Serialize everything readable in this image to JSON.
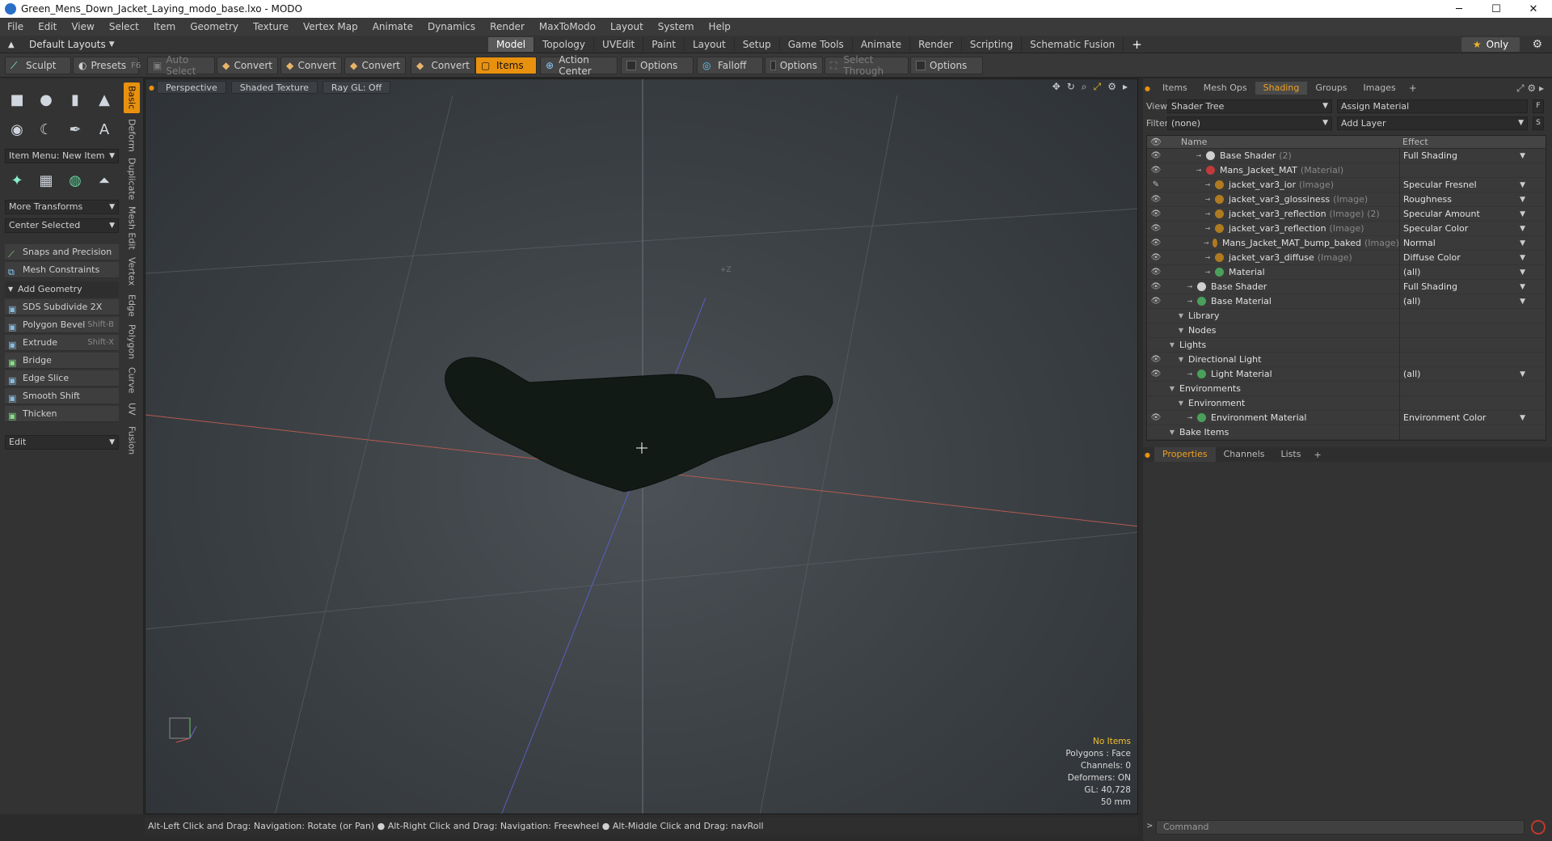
{
  "window": {
    "title": "Green_Mens_Down_Jacket_Laying_modo_base.lxo - MODO",
    "min": "─",
    "max": "☐",
    "close": "✕"
  },
  "menu": [
    "File",
    "Edit",
    "View",
    "Select",
    "Item",
    "Geometry",
    "Texture",
    "Vertex Map",
    "Animate",
    "Dynamics",
    "Render",
    "MaxToModo",
    "Layout",
    "System",
    "Help"
  ],
  "layout": {
    "name": "Default Layouts",
    "tabs": [
      "Model",
      "Topology",
      "UVEdit",
      "Paint",
      "Layout",
      "Setup",
      "Game Tools",
      "Animate",
      "Render",
      "Scripting",
      "Schematic Fusion"
    ],
    "active_tab": "Model",
    "only": "Only"
  },
  "toolbar": {
    "sculpt": "Sculpt",
    "presets": "Presets",
    "presets_key": "F6",
    "auto_select": "Auto Select",
    "convert": "Convert",
    "items": "Items",
    "action_center": "Action Center",
    "options": "Options",
    "falloff": "Falloff",
    "select_through": "Select Through"
  },
  "left": {
    "vtabs": [
      "Basic",
      "Deform",
      "Duplicate",
      "Mesh Edit",
      "Vertex",
      "Edge",
      "Polygon",
      "Curve",
      "UV",
      "Fusion"
    ],
    "item_menu": "Item Menu: New Item",
    "more_transforms": "More Transforms",
    "center_selected": "Center Selected",
    "snaps": "Snaps and Precision",
    "mesh_constraints": "Mesh Constraints",
    "add_geometry": "Add Geometry",
    "tools": [
      {
        "label": "SDS Subdivide 2X",
        "key": ""
      },
      {
        "label": "Polygon Bevel",
        "key": "Shift-B"
      },
      {
        "label": "Extrude",
        "key": "Shift-X"
      },
      {
        "label": "Bridge",
        "key": ""
      },
      {
        "label": "Edge Slice",
        "key": ""
      },
      {
        "label": "Smooth Shift",
        "key": ""
      },
      {
        "label": "Thicken",
        "key": ""
      }
    ],
    "edit": "Edit"
  },
  "viewport": {
    "view": "Perspective",
    "shading": "Shaded Texture",
    "raygl": "Ray GL: Off",
    "axis_label": "+Z",
    "info": [
      "No Items",
      "Polygons : Face",
      "Channels: 0",
      "Deformers: ON",
      "GL: 40,728",
      "50 mm"
    ]
  },
  "status": "Alt-Left Click and Drag: Navigation: Rotate (or Pan) ● Alt-Right Click and Drag: Navigation: Freewheel ● Alt-Middle Click and Drag: navRoll",
  "right": {
    "tabs": [
      "Items",
      "Mesh Ops",
      "Shading",
      "Groups",
      "Images"
    ],
    "active_tab": "Shading",
    "view_label": "View",
    "view_value": "Shader Tree",
    "assign": "Assign Material",
    "filter_label": "Filter",
    "filter_value": "(none)",
    "add_layer": "Add Layer",
    "col_name": "Name",
    "col_effect": "Effect",
    "rows": [
      {
        "indent": 3,
        "name": "Base Shader",
        "muted": "(2)",
        "effect": "Full Shading",
        "ball": "#d0d0d0",
        "eye": "👁"
      },
      {
        "indent": 3,
        "name": "Mans_Jacket_MAT",
        "muted": "(Material)",
        "effect": "",
        "ball": "#c03a3a",
        "eye": "👁"
      },
      {
        "indent": 4,
        "name": "jacket_var3_ior",
        "muted": "(Image)",
        "effect": "Specular Fresnel",
        "ball": "#b07a20",
        "eye": "✎"
      },
      {
        "indent": 4,
        "name": "jacket_var3_glossiness",
        "muted": "(Image)",
        "effect": "Roughness",
        "ball": "#b07a20",
        "eye": "👁"
      },
      {
        "indent": 4,
        "name": "jacket_var3_reflection",
        "muted": "(Image) (2)",
        "effect": "Specular Amount",
        "ball": "#b07a20",
        "eye": "👁"
      },
      {
        "indent": 4,
        "name": "jacket_var3_reflection",
        "muted": "(Image)",
        "effect": "Specular Color",
        "ball": "#b07a20",
        "eye": "👁"
      },
      {
        "indent": 4,
        "name": "Mans_Jacket_MAT_bump_baked",
        "muted": "(Image)",
        "effect": "Normal",
        "ball": "#b07a20",
        "eye": "👁"
      },
      {
        "indent": 4,
        "name": "jacket_var3_diffuse",
        "muted": "(Image)",
        "effect": "Diffuse Color",
        "ball": "#b07a20",
        "eye": "👁"
      },
      {
        "indent": 4,
        "name": "Material",
        "muted": "",
        "effect": "(all)",
        "ball": "#4aa05a",
        "eye": "👁"
      },
      {
        "indent": 2,
        "name": "Base Shader",
        "muted": "",
        "effect": "Full Shading",
        "ball": "#d0d0d0",
        "eye": "👁"
      },
      {
        "indent": 2,
        "name": "Base Material",
        "muted": "",
        "effect": "(all)",
        "ball": "#4aa05a",
        "eye": "👁"
      },
      {
        "indent": 1,
        "name": "Library",
        "muted": "",
        "effect": "",
        "ball": "",
        "eye": ""
      },
      {
        "indent": 1,
        "name": "Nodes",
        "muted": "",
        "effect": "",
        "ball": "",
        "eye": ""
      },
      {
        "indent": 0,
        "name": "Lights",
        "muted": "",
        "effect": "",
        "ball": "",
        "eye": ""
      },
      {
        "indent": 1,
        "name": "Directional Light",
        "muted": "",
        "effect": "",
        "ball": "",
        "eye": "👁"
      },
      {
        "indent": 2,
        "name": "Light Material",
        "muted": "",
        "effect": "(all)",
        "ball": "#4aa05a",
        "eye": "👁"
      },
      {
        "indent": 0,
        "name": "Environments",
        "muted": "",
        "effect": "",
        "ball": "",
        "eye": ""
      },
      {
        "indent": 1,
        "name": "Environment",
        "muted": "",
        "effect": "",
        "ball": "",
        "eye": ""
      },
      {
        "indent": 2,
        "name": "Environment Material",
        "muted": "",
        "effect": "Environment Color",
        "ball": "#4aa05a",
        "eye": "👁"
      },
      {
        "indent": 0,
        "name": "Bake Items",
        "muted": "",
        "effect": "",
        "ball": "",
        "eye": ""
      }
    ],
    "props_tabs": [
      "Properties",
      "Channels",
      "Lists"
    ],
    "command": "Command"
  }
}
